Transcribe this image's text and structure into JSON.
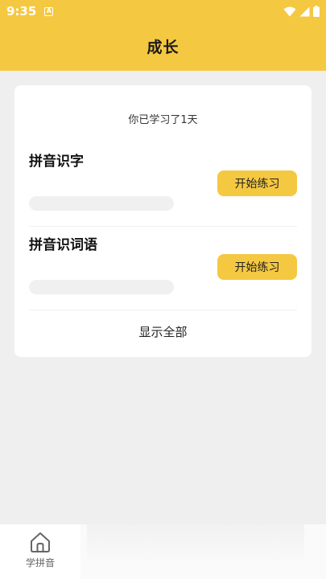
{
  "status_bar": {
    "time": "9:35",
    "notification_icon_letter": "A",
    "icons": [
      "wifi-icon",
      "signal-icon",
      "battery-icon"
    ]
  },
  "header": {
    "title": "成长",
    "background_color": "#f5c842"
  },
  "card": {
    "days_text": "你已学习了1天",
    "sections": [
      {
        "title": "拼音识字",
        "button_label": "开始练习",
        "progress": 0
      },
      {
        "title": "拼音识词语",
        "button_label": "开始练习",
        "progress": 0
      }
    ],
    "show_all_label": "显示全部"
  },
  "bottom_nav": {
    "items": [
      {
        "label": "学拼音",
        "icon": "home-icon"
      }
    ]
  }
}
